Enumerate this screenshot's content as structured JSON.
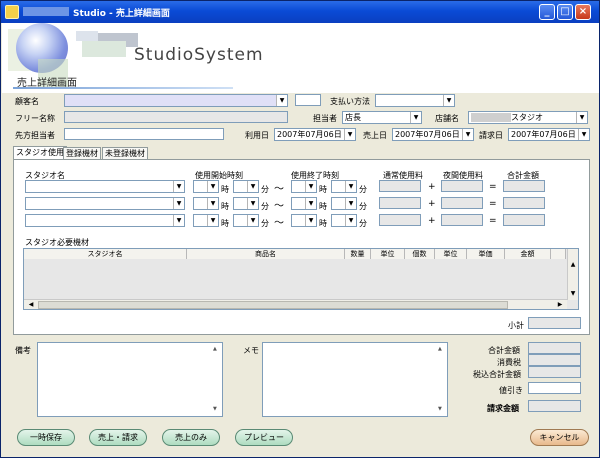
{
  "window": {
    "title": "Studio - 売上詳細画面"
  },
  "brand": "StudioSystem",
  "page_title": "売上詳細画面",
  "form": {
    "customer_label": "顧客名",
    "payment_label": "支払い方法",
    "free_name_label": "フリー名称",
    "staff_label": "担当者",
    "staff_value": "店長",
    "store_label": "店舗名",
    "store_value": "スタジオ",
    "contact_label": "先方担当者",
    "use_date_label": "利用日",
    "use_date_value": "2007年07月06日",
    "sales_date_label": "売上日",
    "sales_date_value": "2007年07月06日",
    "bill_date_label": "請求日",
    "bill_date_value": "2007年07月06日"
  },
  "tabs": [
    "スタジオ使用",
    "登録機材",
    "未登録機材"
  ],
  "studio": {
    "col_studio": "スタジオ名",
    "col_start": "使用開始時刻",
    "col_end": "使用終了時刻",
    "col_normal": "通常使用料",
    "col_night": "夜間使用料",
    "col_total": "合計金額",
    "hour": "時",
    "minute": "分",
    "tilde": "～",
    "plus": "+",
    "equals": "=",
    "equipment_label": "スタジオ必要機材"
  },
  "grid_headers": [
    "スタジオ名",
    "商品名",
    "数量",
    "単位",
    "個数",
    "単位",
    "単価",
    "金額"
  ],
  "subtotal_label": "小計",
  "remarks_label": "備考",
  "memo_label": "メモ",
  "summary": [
    "合計金額",
    "消費税",
    "税込合計金額",
    "値引き",
    "請求金額"
  ],
  "buttons": {
    "temp_save": "一時保存",
    "sales_bill": "売上・請求",
    "sales_only": "売上のみ",
    "preview": "プレビュー",
    "cancel": "キャンセル"
  }
}
